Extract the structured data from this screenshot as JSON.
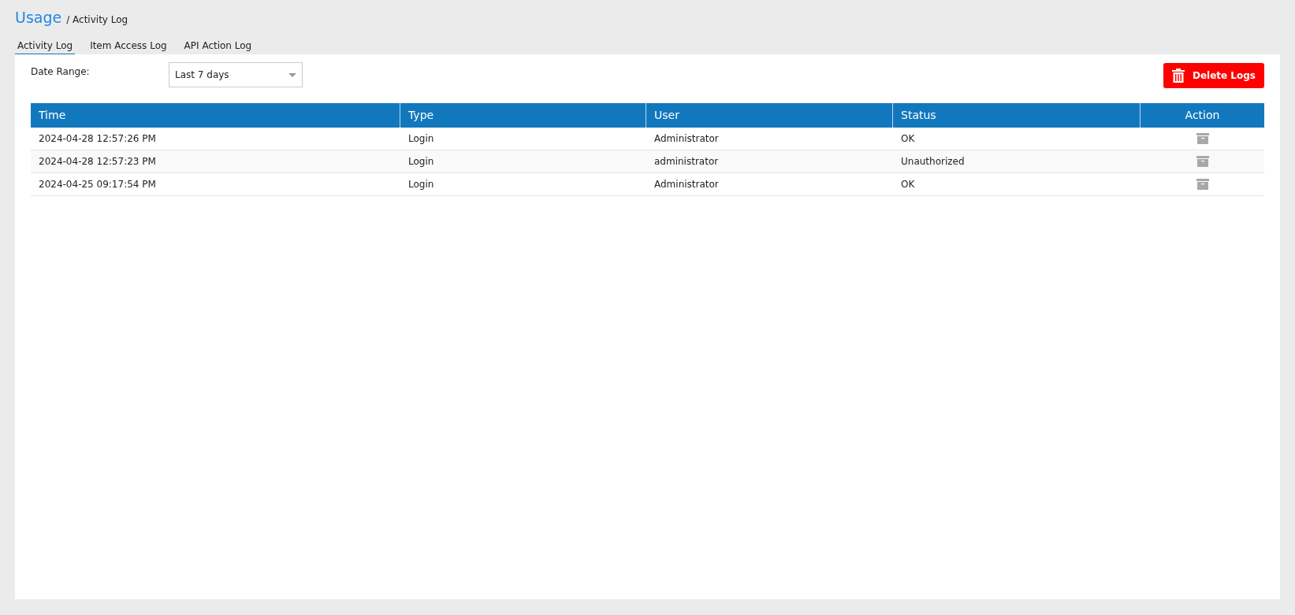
{
  "breadcrumb": {
    "title": "Usage",
    "current": "/ Activity Log"
  },
  "tabs": [
    {
      "label": "Activity Log",
      "selected": true
    },
    {
      "label": "Item Access Log",
      "selected": false
    },
    {
      "label": "API Action Log",
      "selected": false
    }
  ],
  "filter": {
    "label": "Date Range:",
    "value": "Last 7 days"
  },
  "delete_button": {
    "label": "Delete Logs"
  },
  "table": {
    "columns": [
      "Time",
      "Type",
      "User",
      "Status",
      "Action"
    ],
    "rows": [
      {
        "time": "2024-04-28 12:57:26 PM",
        "type": "Login",
        "user": "Administrator",
        "status": "OK"
      },
      {
        "time": "2024-04-28 12:57:23 PM",
        "type": "Login",
        "user": "administrator",
        "status": "Unauthorized"
      },
      {
        "time": "2024-04-25 09:17:54 PM",
        "type": "Login",
        "user": "Administrator",
        "status": "OK"
      }
    ]
  }
}
